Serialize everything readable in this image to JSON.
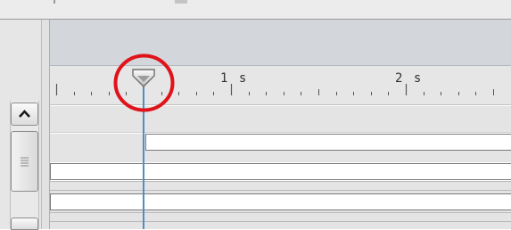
{
  "ruler": {
    "marks": [
      {
        "label": "1 s",
        "time_s": 1
      },
      {
        "label": "2 s",
        "time_s": 2
      }
    ]
  },
  "playhead": {
    "time_s": 0.5,
    "highlighted": true,
    "highlight_color": "#e0121a",
    "line_color": "#4f8fc4"
  },
  "scrollbar": {
    "up_icon": "chevron-up-icon",
    "grip_icon": "grip-lines-icon"
  },
  "colors": {
    "header_band": "#d3d6db",
    "ruler_bg": "#e6e6e6",
    "clip_fill": "#ffffff",
    "clip_border": "#7a7a7a"
  }
}
